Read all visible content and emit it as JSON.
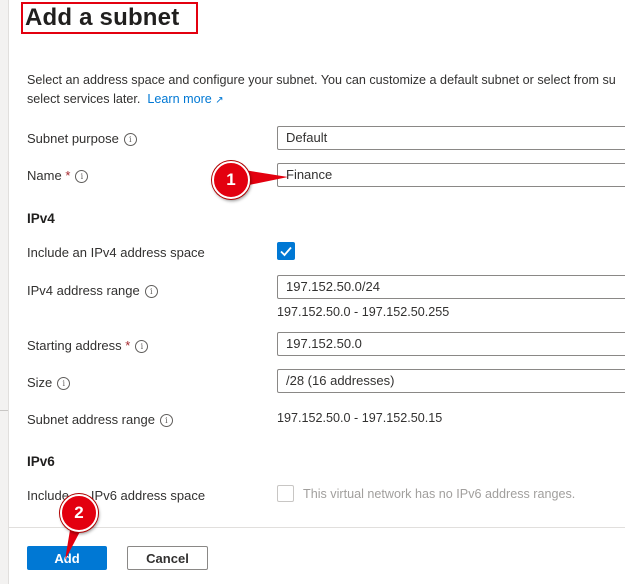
{
  "panel": {
    "title": "Add a subnet",
    "description": "Select an address space and configure your subnet. You can customize a default subnet or select from su",
    "description_line2": "select services later.",
    "learn_more": "Learn more",
    "external_link_icon": "external-link-icon"
  },
  "fields": {
    "subnet_purpose_label": "Subnet purpose",
    "subnet_purpose_value": "Default",
    "name_label": "Name",
    "name_value": "Finance",
    "required_mark": "*",
    "ipv4_heading": "IPv4",
    "include_ipv4_label": "Include an IPv4 address space",
    "include_ipv4_checked": true,
    "ipv4_range_label": "IPv4 address range",
    "ipv4_range_value": "197.152.50.0/24",
    "ipv4_range_span": "197.152.50.0 - 197.152.50.255",
    "starting_address_label": "Starting address",
    "starting_address_value": "197.152.50.0",
    "size_label": "Size",
    "size_value": "/28 (16 addresses)",
    "subnet_range_label": "Subnet address range",
    "subnet_range_value": "197.152.50.0 - 197.152.50.15",
    "ipv6_heading": "IPv6",
    "include_ipv6_label_start": "Include",
    "include_ipv6_label_end": "IPv6 address space",
    "include_ipv6_checked": false,
    "ipv6_disabled_text": "This virtual network has no IPv6 address ranges."
  },
  "footer": {
    "add_label": "Add",
    "cancel_label": "Cancel"
  },
  "annotations": {
    "badge_1": "1",
    "badge_2": "2"
  },
  "colors": {
    "accent": "#0078d4",
    "annotation_red": "#e3000f"
  }
}
